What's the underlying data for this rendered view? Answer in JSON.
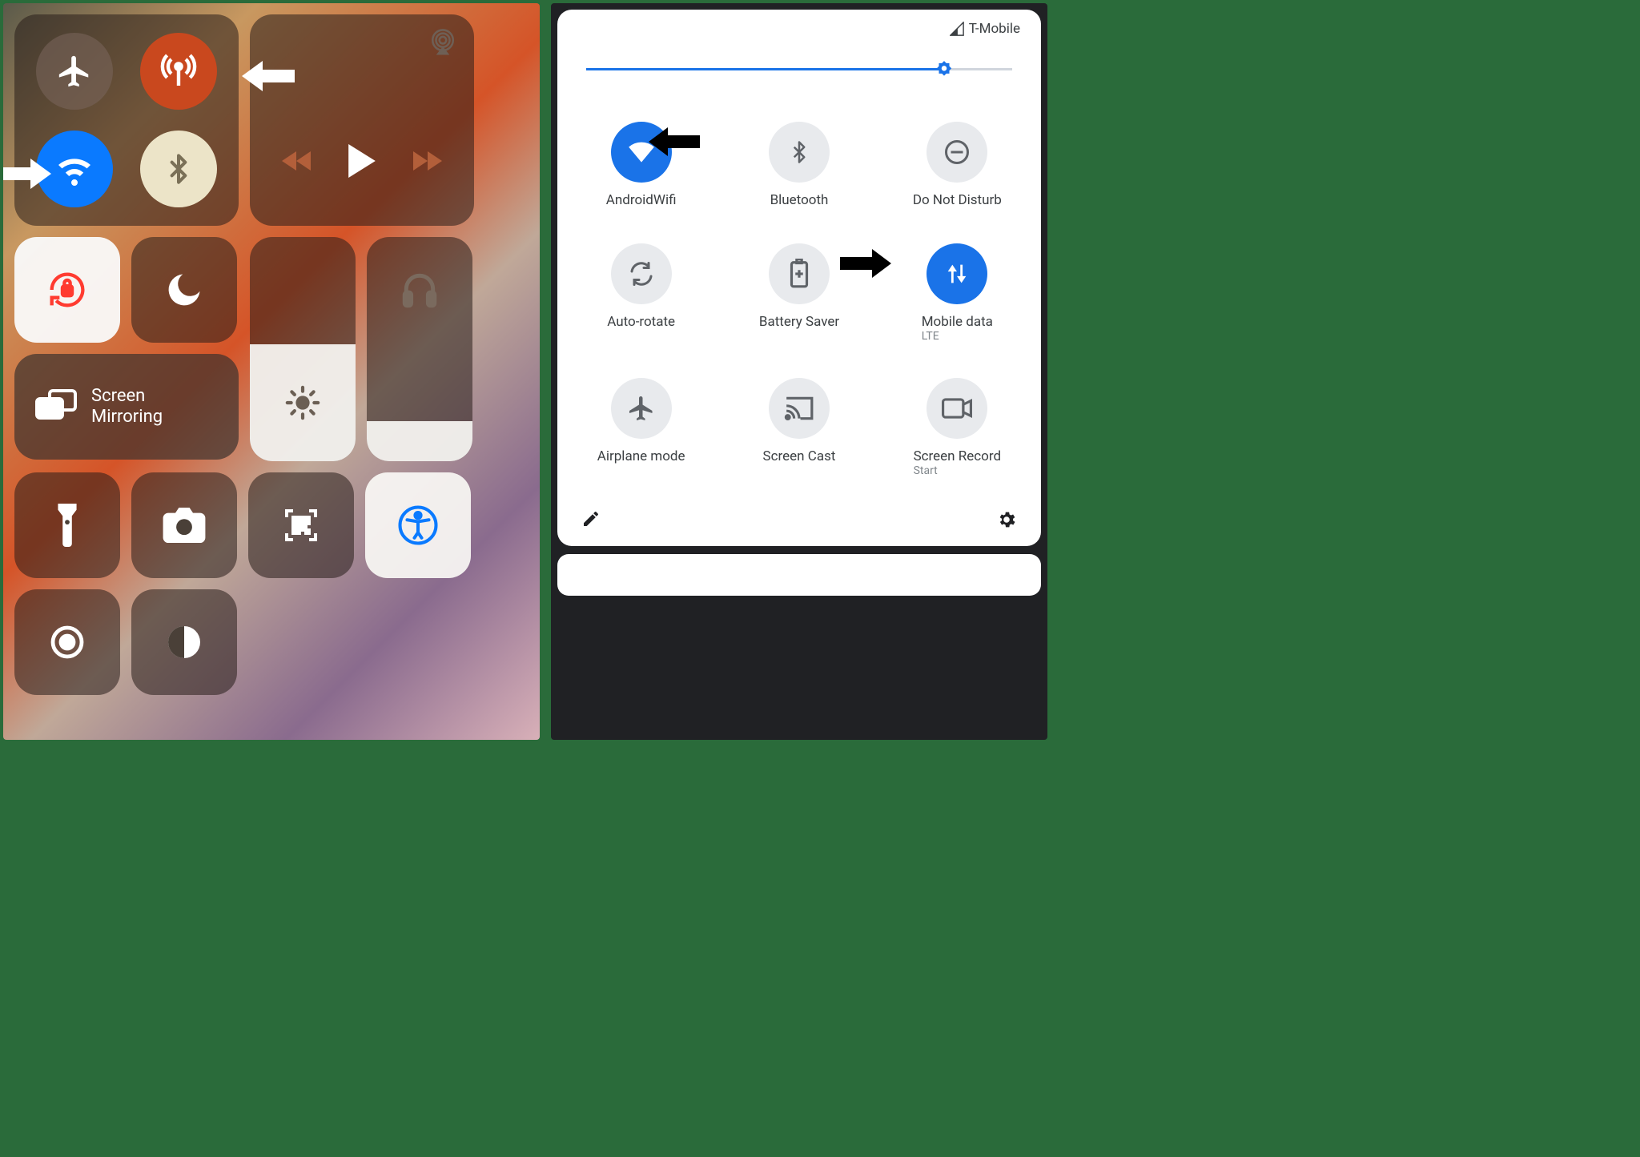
{
  "ios": {
    "screen_mirroring": "Screen\nMirroring"
  },
  "android": {
    "carrier": "T-Mobile",
    "tiles": {
      "wifi": "AndroidWifi",
      "bluetooth": "Bluetooth",
      "dnd": "Do Not Disturb",
      "autorotate": "Auto-rotate",
      "battery": "Battery Saver",
      "mobiledata": "Mobile data",
      "mobiledata_sub": "LTE",
      "airplane": "Airplane mode",
      "cast": "Screen Cast",
      "record": "Screen Record",
      "record_sub": "Start"
    },
    "brightness_pct": 84
  }
}
